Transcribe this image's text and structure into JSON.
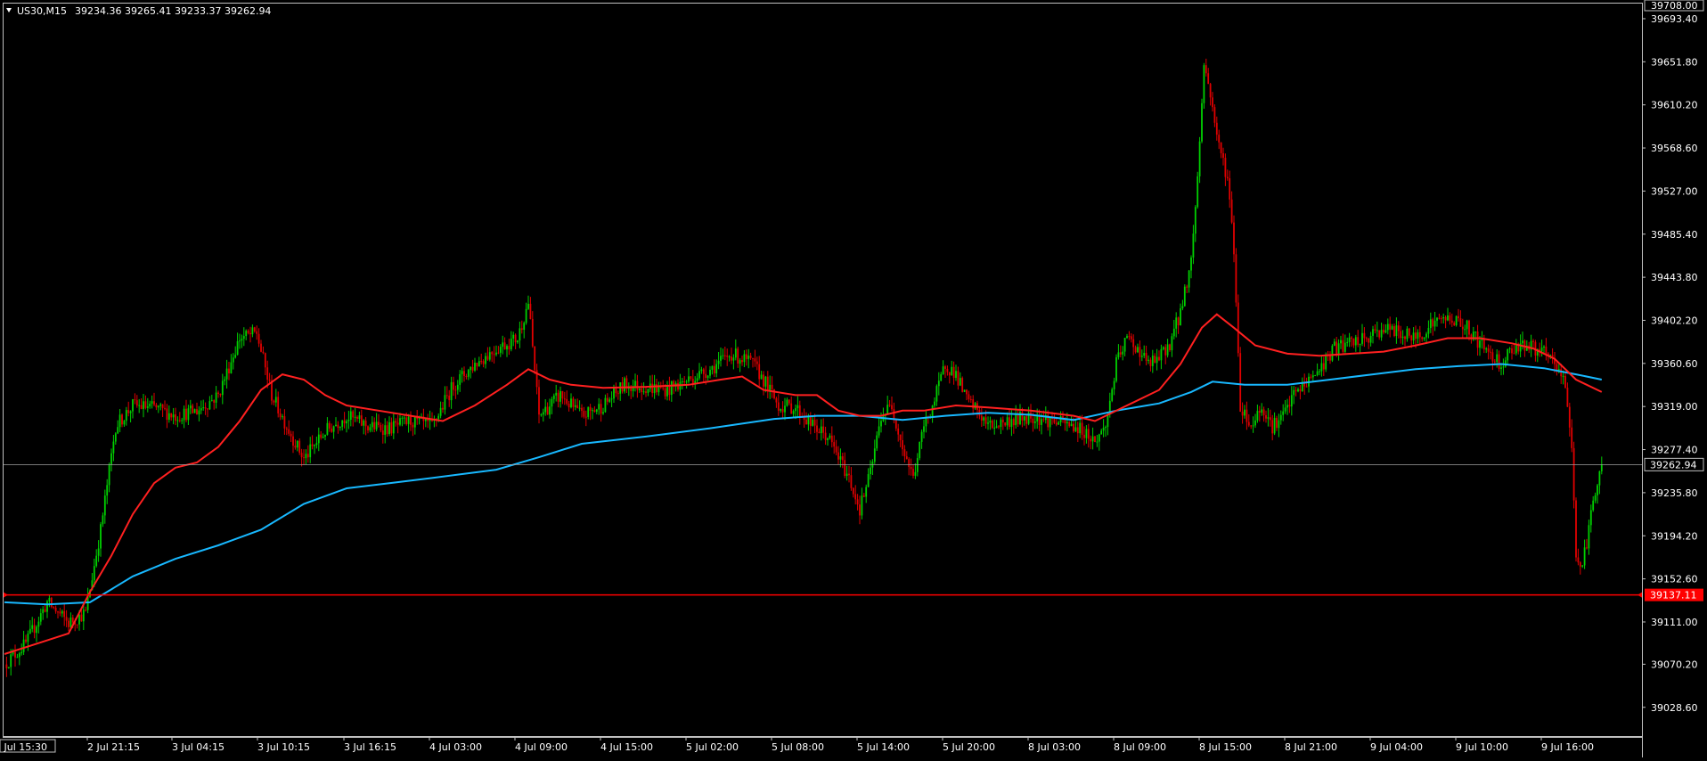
{
  "header": {
    "symbol": "US30,M15",
    "ohlc": "39234.36 39265.41 39233.37 39262.94"
  },
  "colors": {
    "background": "#000000",
    "frame": "#c0c0c0",
    "bull": "#00d000",
    "bear": "#e00000",
    "ma_fast": "#ff2020",
    "ma_slow": "#18b8ff",
    "price_line": "#a0a0a0",
    "hline": "#ff0000",
    "text": "#ffffff"
  },
  "chart_data": {
    "type": "candlestick",
    "ylim": [
      39000,
      39708
    ],
    "y_ticks": [
      39693.4,
      39651.8,
      39610.2,
      39568.6,
      39527.0,
      39485.4,
      39443.8,
      39402.2,
      39360.6,
      39319.0,
      39277.4,
      39235.8,
      39194.2,
      39152.6,
      39111.0,
      39070.2,
      39028.6
    ],
    "y_tick_labels": [
      "39693.40",
      "39651.80",
      "39610.20",
      "39568.60",
      "39527.00",
      "39485.40",
      "39443.80",
      "39402.20",
      "39360.60",
      "39319.00",
      "39277.40",
      "39235.80",
      "39194.20",
      "39152.60",
      "39111.00",
      "39070.20",
      "39028.60"
    ],
    "top_label": "39708.00",
    "x_labels": [
      "2 Jul 15:30",
      "2 Jul 21:15",
      "3 Jul 04:15",
      "3 Jul 10:15",
      "3 Jul 16:15",
      "4 Jul 03:00",
      "4 Jul 09:00",
      "4 Jul 15:00",
      "5 Jul 02:00",
      "5 Jul 08:00",
      "5 Jul 14:00",
      "5 Jul 20:00",
      "8 Jul 03:00",
      "8 Jul 09:00",
      "8 Jul 15:00",
      "8 Jul 21:00",
      "9 Jul 04:00",
      "9 Jul 10:00",
      "9 Jul 16:00"
    ],
    "current_price": 39262.94,
    "current_price_label": "39262.94",
    "hline_price": 39137.11,
    "hline_label": "39137.11",
    "price_path": [
      [
        0,
        39070
      ],
      [
        10,
        39090
      ],
      [
        20,
        39130
      ],
      [
        30,
        39110
      ],
      [
        38,
        39120
      ],
      [
        45,
        39200
      ],
      [
        52,
        39300
      ],
      [
        60,
        39320
      ],
      [
        70,
        39318
      ],
      [
        80,
        39310
      ],
      [
        90,
        39315
      ],
      [
        100,
        39330
      ],
      [
        110,
        39385
      ],
      [
        118,
        39390
      ],
      [
        125,
        39330
      ],
      [
        132,
        39300
      ],
      [
        140,
        39268
      ],
      [
        150,
        39295
      ],
      [
        160,
        39310
      ],
      [
        170,
        39300
      ],
      [
        180,
        39298
      ],
      [
        190,
        39305
      ],
      [
        200,
        39300
      ],
      [
        210,
        39340
      ],
      [
        220,
        39360
      ],
      [
        230,
        39375
      ],
      [
        240,
        39385
      ],
      [
        245,
        39420
      ],
      [
        250,
        39310
      ],
      [
        260,
        39330
      ],
      [
        270,
        39310
      ],
      [
        280,
        39320
      ],
      [
        290,
        39340
      ],
      [
        300,
        39338
      ],
      [
        310,
        39335
      ],
      [
        320,
        39345
      ],
      [
        330,
        39355
      ],
      [
        340,
        39370
      ],
      [
        350,
        39360
      ],
      [
        355,
        39345
      ],
      [
        362,
        39320
      ],
      [
        370,
        39318
      ],
      [
        378,
        39300
      ],
      [
        385,
        39290
      ],
      [
        390,
        39270
      ],
      [
        395,
        39250
      ],
      [
        400,
        39220
      ],
      [
        405,
        39255
      ],
      [
        410,
        39310
      ],
      [
        415,
        39320
      ],
      [
        420,
        39280
      ],
      [
        425,
        39250
      ],
      [
        430,
        39300
      ],
      [
        435,
        39325
      ],
      [
        440,
        39360
      ],
      [
        445,
        39350
      ],
      [
        450,
        39325
      ],
      [
        455,
        39315
      ],
      [
        460,
        39300
      ],
      [
        470,
        39305
      ],
      [
        480,
        39310
      ],
      [
        490,
        39305
      ],
      [
        500,
        39300
      ],
      [
        505,
        39295
      ],
      [
        510,
        39285
      ],
      [
        515,
        39300
      ],
      [
        520,
        39360
      ],
      [
        525,
        39385
      ],
      [
        530,
        39375
      ],
      [
        535,
        39360
      ],
      [
        540,
        39365
      ],
      [
        545,
        39380
      ],
      [
        550,
        39410
      ],
      [
        555,
        39460
      ],
      [
        558,
        39540
      ],
      [
        561,
        39650
      ],
      [
        564,
        39620
      ],
      [
        568,
        39570
      ],
      [
        572,
        39540
      ],
      [
        575,
        39470
      ],
      [
        578,
        39320
      ],
      [
        583,
        39300
      ],
      [
        588,
        39320
      ],
      [
        593,
        39300
      ],
      [
        598,
        39310
      ],
      [
        603,
        39330
      ],
      [
        608,
        39340
      ],
      [
        615,
        39355
      ],
      [
        622,
        39375
      ],
      [
        630,
        39380
      ],
      [
        638,
        39385
      ],
      [
        645,
        39395
      ],
      [
        652,
        39390
      ],
      [
        660,
        39385
      ],
      [
        668,
        39400
      ],
      [
        676,
        39405
      ],
      [
        684,
        39395
      ],
      [
        690,
        39380
      ],
      [
        695,
        39370
      ],
      [
        700,
        39360
      ],
      [
        705,
        39375
      ],
      [
        710,
        39380
      ],
      [
        715,
        39375
      ],
      [
        720,
        39370
      ],
      [
        725,
        39360
      ],
      [
        730,
        39340
      ],
      [
        733,
        39280
      ],
      [
        735,
        39175
      ],
      [
        738,
        39165
      ],
      [
        741,
        39200
      ],
      [
        744,
        39240
      ],
      [
        747,
        39262.94
      ]
    ],
    "ma_fast_path": [
      [
        0,
        39080
      ],
      [
        15,
        39090
      ],
      [
        30,
        39100
      ],
      [
        40,
        39140
      ],
      [
        50,
        39175
      ],
      [
        60,
        39215
      ],
      [
        70,
        39245
      ],
      [
        80,
        39260
      ],
      [
        90,
        39265
      ],
      [
        100,
        39280
      ],
      [
        110,
        39305
      ],
      [
        120,
        39335
      ],
      [
        130,
        39350
      ],
      [
        140,
        39345
      ],
      [
        150,
        39330
      ],
      [
        160,
        39320
      ],
      [
        175,
        39315
      ],
      [
        190,
        39310
      ],
      [
        205,
        39305
      ],
      [
        220,
        39320
      ],
      [
        235,
        39340
      ],
      [
        245,
        39355
      ],
      [
        255,
        39345
      ],
      [
        265,
        39340
      ],
      [
        280,
        39337
      ],
      [
        300,
        39338
      ],
      [
        320,
        39340
      ],
      [
        335,
        39345
      ],
      [
        345,
        39348
      ],
      [
        355,
        39335
      ],
      [
        370,
        39330
      ],
      [
        380,
        39330
      ],
      [
        390,
        39315
      ],
      [
        400,
        39310
      ],
      [
        410,
        39310
      ],
      [
        420,
        39315
      ],
      [
        430,
        39315
      ],
      [
        445,
        39320
      ],
      [
        460,
        39318
      ],
      [
        480,
        39315
      ],
      [
        500,
        39310
      ],
      [
        510,
        39305
      ],
      [
        525,
        39320
      ],
      [
        540,
        39335
      ],
      [
        550,
        39360
      ],
      [
        560,
        39395
      ],
      [
        567,
        39408
      ],
      [
        575,
        39395
      ],
      [
        585,
        39378
      ],
      [
        600,
        39370
      ],
      [
        615,
        39368
      ],
      [
        630,
        39370
      ],
      [
        645,
        39372
      ],
      [
        660,
        39378
      ],
      [
        675,
        39385
      ],
      [
        690,
        39385
      ],
      [
        705,
        39380
      ],
      [
        715,
        39375
      ],
      [
        725,
        39365
      ],
      [
        735,
        39345
      ],
      [
        740,
        39340
      ],
      [
        747,
        39333
      ]
    ],
    "ma_slow_path": [
      [
        0,
        39130
      ],
      [
        20,
        39128
      ],
      [
        40,
        39130
      ],
      [
        60,
        39155
      ],
      [
        80,
        39172
      ],
      [
        100,
        39185
      ],
      [
        120,
        39200
      ],
      [
        140,
        39225
      ],
      [
        160,
        39240
      ],
      [
        180,
        39245
      ],
      [
        200,
        39250
      ],
      [
        230,
        39258
      ],
      [
        250,
        39270
      ],
      [
        270,
        39283
      ],
      [
        300,
        39290
      ],
      [
        330,
        39298
      ],
      [
        360,
        39307
      ],
      [
        380,
        39310
      ],
      [
        400,
        39310
      ],
      [
        420,
        39306
      ],
      [
        440,
        39310
      ],
      [
        460,
        39313
      ],
      [
        480,
        39311
      ],
      [
        500,
        39306
      ],
      [
        520,
        39315
      ],
      [
        540,
        39322
      ],
      [
        555,
        39333
      ],
      [
        565,
        39343
      ],
      [
        580,
        39340
      ],
      [
        600,
        39340
      ],
      [
        620,
        39345
      ],
      [
        640,
        39350
      ],
      [
        660,
        39355
      ],
      [
        680,
        39358
      ],
      [
        700,
        39360
      ],
      [
        720,
        39356
      ],
      [
        735,
        39350
      ],
      [
        747,
        39345
      ]
    ]
  }
}
